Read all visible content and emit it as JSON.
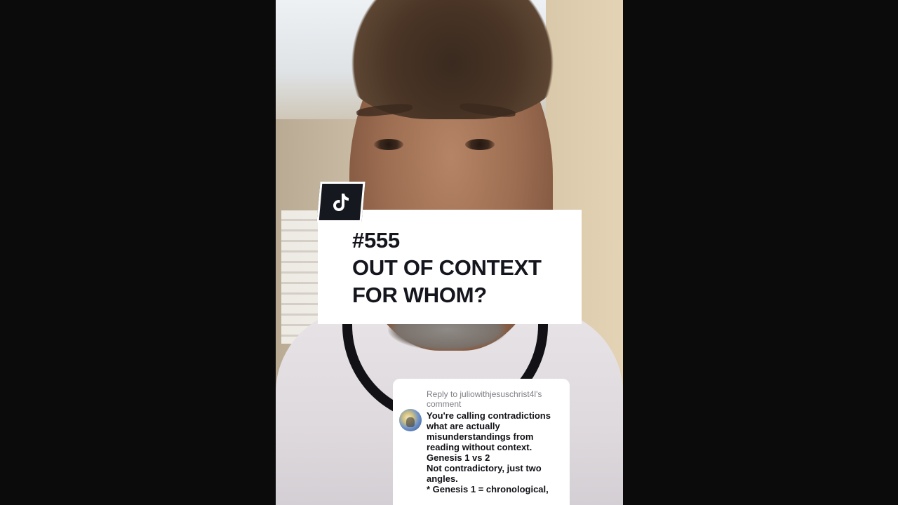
{
  "video": {
    "title_lines": [
      "#555",
      "OUT OF CONTEXT",
      "FOR WHOM?"
    ],
    "badge_icon": "tiktok-logo-icon"
  },
  "comment": {
    "reply_label_lines": [
      "Reply to juliowithjesuschrist4l's",
      "comment"
    ],
    "body_lines": [
      "You're calling contradictions",
      "what are actually",
      "misunderstandings from",
      "reading without context.",
      "Genesis 1 vs 2",
      "Not contradictory, just two",
      "angles.",
      "* Genesis 1 = chronological,"
    ]
  },
  "colors": {
    "background": "#0b0b0c",
    "card_bg": "#ffffff",
    "title_text": "#15161d",
    "reply_text": "#7e7f86"
  }
}
